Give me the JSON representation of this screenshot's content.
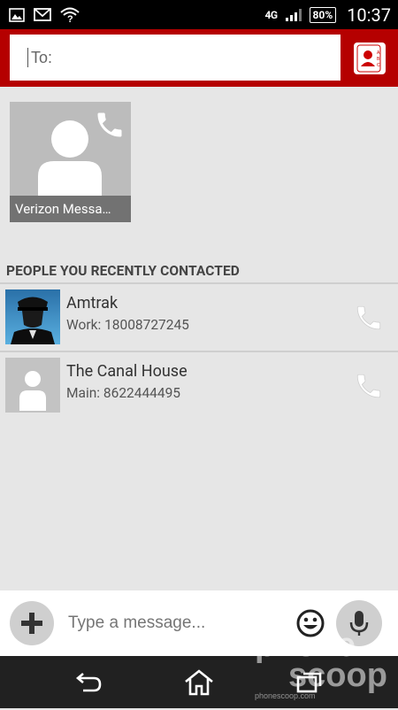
{
  "status_bar": {
    "network": "4G",
    "battery": "80%",
    "time": "10:37"
  },
  "header": {
    "to_placeholder": "To:"
  },
  "favorite_tile": {
    "label": "Verizon Messa…"
  },
  "recent": {
    "title": "PEOPLE YOU RECENTLY CONTACTED",
    "contacts": [
      {
        "name": "Amtrak",
        "detail": "Work: 18008727245"
      },
      {
        "name": "The Canal House",
        "detail": "Main: 8622444495"
      }
    ]
  },
  "composer": {
    "placeholder": "Type a message..."
  },
  "watermark": {
    "line1": "phone",
    "line2": "scoop",
    "url": "phonescoop.com"
  },
  "colors": {
    "header": "#b50000",
    "background": "#e6e6e6",
    "nav": "#212121"
  }
}
